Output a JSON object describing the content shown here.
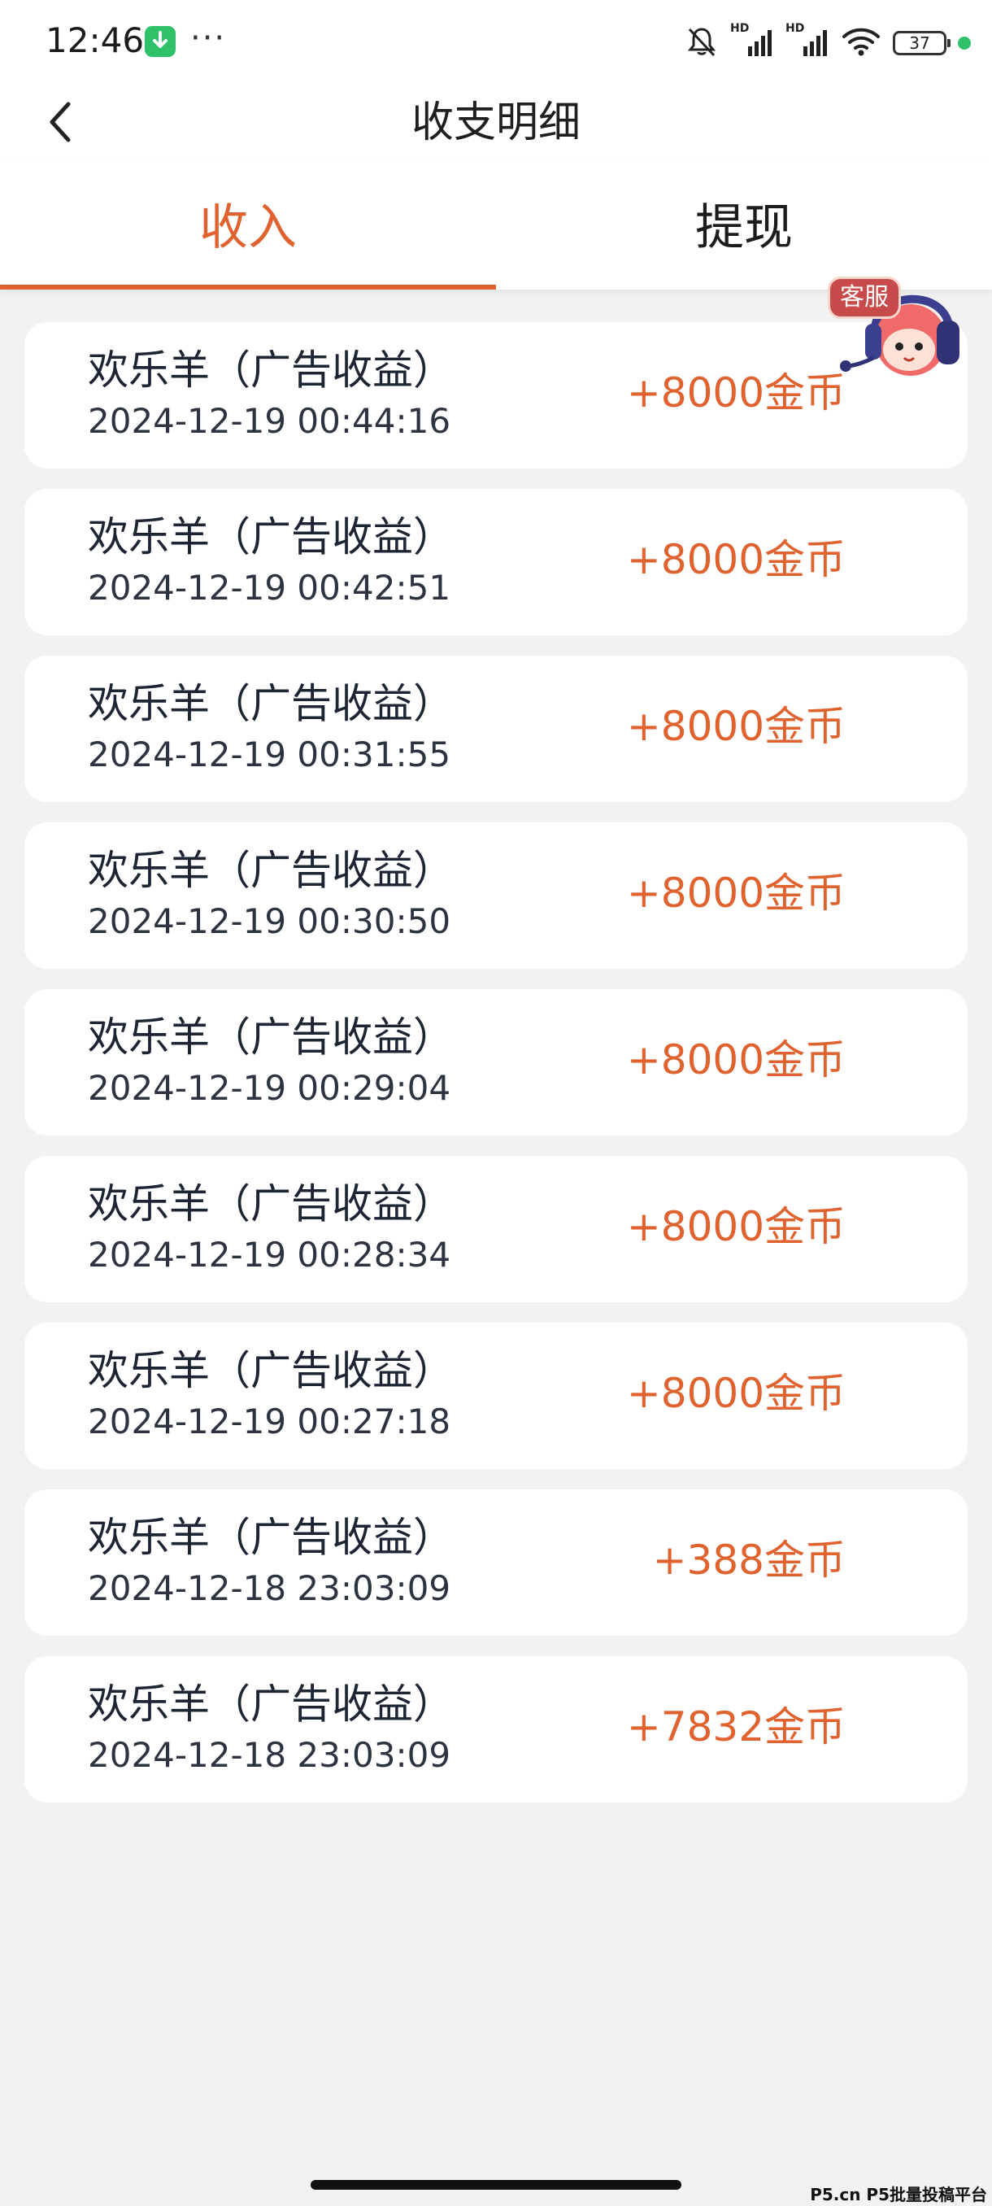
{
  "status_bar": {
    "time": "12:46",
    "more": "···",
    "battery": "37",
    "icons": [
      "download-notification-icon",
      "mute-bell-icon",
      "hd-signal-icon",
      "hd-signal-icon",
      "wifi-icon",
      "battery-icon"
    ]
  },
  "nav": {
    "title": "收支明细",
    "back_icon": "chevron-left-icon"
  },
  "tabs": [
    {
      "label": "收入",
      "active": true
    },
    {
      "label": "提现",
      "active": false
    }
  ],
  "service": {
    "label": "客服",
    "icon": "customer-service-mascot-icon"
  },
  "records": [
    {
      "title": "欢乐羊（广告收益）",
      "time": "2024-12-19 00:44:16",
      "amount": "+8000金币"
    },
    {
      "title": "欢乐羊（广告收益）",
      "time": "2024-12-19 00:42:51",
      "amount": "+8000金币"
    },
    {
      "title": "欢乐羊（广告收益）",
      "time": "2024-12-19 00:31:55",
      "amount": "+8000金币"
    },
    {
      "title": "欢乐羊（广告收益）",
      "time": "2024-12-19 00:30:50",
      "amount": "+8000金币"
    },
    {
      "title": "欢乐羊（广告收益）",
      "time": "2024-12-19 00:29:04",
      "amount": "+8000金币"
    },
    {
      "title": "欢乐羊（广告收益）",
      "time": "2024-12-19 00:28:34",
      "amount": "+8000金币"
    },
    {
      "title": "欢乐羊（广告收益）",
      "time": "2024-12-19 00:27:18",
      "amount": "+8000金币"
    },
    {
      "title": "欢乐羊（广告收益）",
      "time": "2024-12-18 23:03:09",
      "amount": "+388金币"
    },
    {
      "title": "欢乐羊（广告收益）",
      "time": "2024-12-18 23:03:09",
      "amount": "+7832金币"
    }
  ],
  "watermark": "P5.cn P5批量投稿平台",
  "colors": {
    "accent": "#e0622e",
    "background": "#f2f2f2",
    "card": "#ffffff"
  }
}
